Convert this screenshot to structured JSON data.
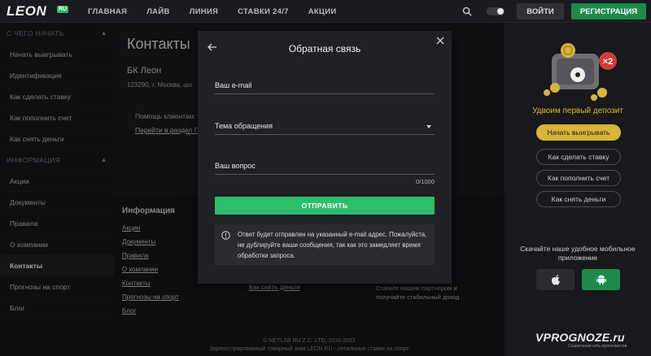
{
  "brand": {
    "logo": "LEON",
    "badge": "RU"
  },
  "nav": [
    "ГЛАВНАЯ",
    "ЛАЙВ",
    "ЛИНИЯ",
    "СТАВКИ 24/7",
    "АКЦИИ"
  ],
  "auth": {
    "login": "ВОЙТИ",
    "register": "РЕГИСТРАЦИЯ"
  },
  "sidebar": {
    "section1": "С ЧЕГО НАЧАТЬ",
    "items1": [
      "Начать выигрывать",
      "Идентификация",
      "Как сделать ставку",
      "Как пополнить счет",
      "Как снять деньги"
    ],
    "section2": "ИНФОРМАЦИЯ",
    "items2": [
      "Акции",
      "Документы",
      "Правила",
      "О компании",
      "Контакты",
      "Прогнозы на спорт",
      "Блог"
    ]
  },
  "main": {
    "title": "Контакты",
    "company": "БК Леон",
    "address": "123290, г. Москва, шо",
    "help": "Помощь клиентам:",
    "help_link": "Перейти в раздел П"
  },
  "footer": {
    "title": "Информация",
    "links": [
      "Акции",
      "Документы",
      "Правила",
      "О компании",
      "Контакты",
      "Прогнозы на спорт",
      "Блог"
    ],
    "link_withdraw": "Как снять деньги",
    "partner": "Станьте нашим партнером и получайте стабильный доход",
    "copyright1": "© NETLAB RU Z.C. LTD, 2016-2021",
    "copyright2": "Зарегистрированный товарный знак LEON.RU - легальные ставки на спорт"
  },
  "modal": {
    "title": "Обратная связь",
    "email_label": "Ваш e-mail",
    "topic_label": "Тема обращения",
    "question_label": "Ваш вопрос",
    "counter": "0/1000",
    "submit": "ОТПРАВИТЬ",
    "notice": "Ответ будет отправлен на указанный e-mail адрес. Пожалуйста, не дублируйте ваши сообщения, так как это замедляет время обработки запроса."
  },
  "promo": {
    "badge": "×2",
    "title": "Удвоим первый депозит",
    "start": "Начать выигрывать",
    "how_bet": "Как сделать ставку",
    "how_deposit": "Как пополнить счет",
    "how_withdraw": "Как снять деньги",
    "app_title": "Скачайте наше удобное мобильное приложение"
  },
  "watermark": {
    "text": "VPROGNOZE.ru",
    "sub": "Социальная сеть прогнозистов"
  },
  "colors": {
    "accent_green": "#2dbe6c",
    "gold": "#d8b43a",
    "bg": "#111214"
  },
  "icons": [
    "search-icon",
    "theme-toggle-icon",
    "back-arrow-icon",
    "close-icon",
    "info-icon",
    "apple-icon",
    "android-icon",
    "chevron-up-icon",
    "select-caret-icon"
  ]
}
